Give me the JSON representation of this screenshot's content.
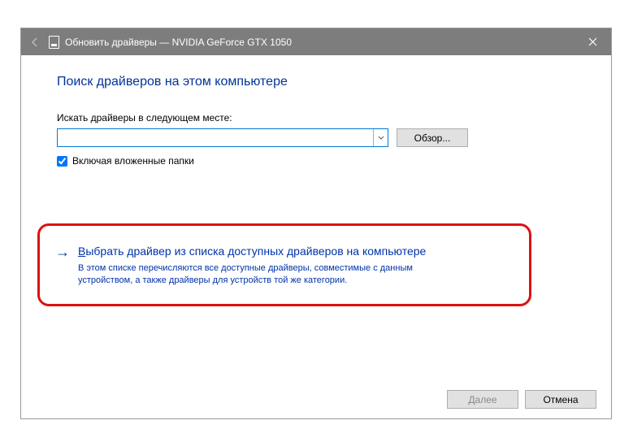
{
  "titlebar": {
    "title": "Обновить драйверы — NVIDIA GeForce GTX 1050"
  },
  "heading": "Поиск драйверов на этом компьютере",
  "search": {
    "label": "Искать драйверы в следующем месте:",
    "value": "",
    "browse": "Обзор..."
  },
  "subfolders": {
    "label": "Включая вложенные папки",
    "checked": true
  },
  "option": {
    "title_prefix": "В",
    "title_rest": "ыбрать драйвер из списка доступных драйверов на компьютере",
    "desc": "В этом списке перечисляются все доступные драйверы, совместимые с данным устройством, а также драйверы для устройств той же категории."
  },
  "footer": {
    "next": "Далее",
    "cancel": "Отмена"
  }
}
